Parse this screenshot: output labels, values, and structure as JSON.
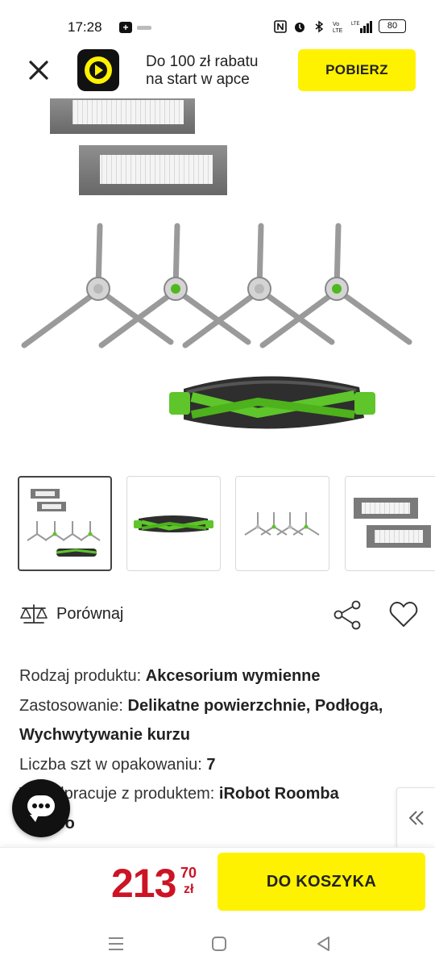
{
  "status_bar": {
    "time": "17:28",
    "notification_icon": "plus-square-icon",
    "right_icons": [
      "nfc-icon",
      "alarm-icon",
      "bluetooth-icon",
      "volte-icon",
      "lte-signal-icon"
    ],
    "battery": "80"
  },
  "app_banner": {
    "close_icon": "close-icon",
    "logo_icon": "play-logo-icon",
    "text_line1": "Do 100 zł rabatu",
    "text_line2": "na start w apce",
    "cta": "POBIERZ"
  },
  "gallery": {
    "selected_index": 0,
    "thumbnails": [
      "thumbnail-set",
      "thumbnail-roller-brush",
      "thumbnail-side-brushes",
      "thumbnail-filters"
    ]
  },
  "actions": {
    "compare_label": "Porównaj",
    "compare_icon": "scale-icon",
    "share_icon": "share-icon",
    "favorite_icon": "heart-icon"
  },
  "specs": [
    {
      "label": "Rodzaj produktu:",
      "value": "Akcesorium wymienne"
    },
    {
      "label": "Zastosowanie:",
      "value": "Delikatne powierzchnie, Podłoga, Wychwytywanie kurzu"
    },
    {
      "label": "Liczba szt w opakowaniu:",
      "value": "7"
    },
    {
      "label": "Współpracuje z produktem:",
      "value": "iRobot Roomba"
    }
  ],
  "specs_cut_line": "Combo",
  "purchase": {
    "price_main": "213",
    "price_cents": "70",
    "currency": "zł",
    "cart_label": "DO KOSZYKA"
  },
  "colors": {
    "accent_yellow": "#fff200",
    "price_red": "#cc1424",
    "brush_green": "#5ec52b",
    "filter_gray": "#7a7a7a"
  }
}
